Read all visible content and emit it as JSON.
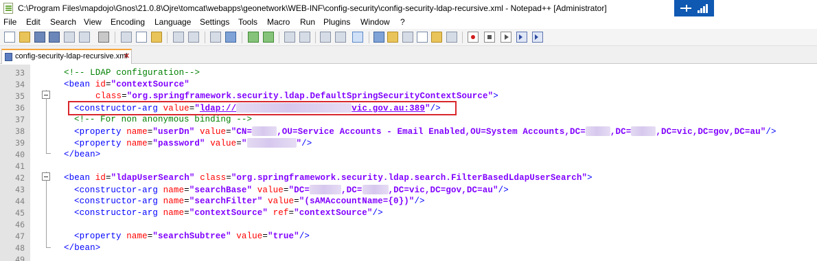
{
  "window": {
    "title": "C:\\Program Files\\mapdojo\\Gnos\\21.0.8\\Ojre\\tomcat\\webapps\\geonetwork\\WEB-INF\\config-security\\config-security-ldap-recursive.xml - Notepad++ [Administrator]",
    "tray_color": "#0f59b2"
  },
  "menu": [
    "File",
    "Edit",
    "Search",
    "View",
    "Encoding",
    "Language",
    "Settings",
    "Tools",
    "Macro",
    "Run",
    "Plugins",
    "Window",
    "?"
  ],
  "toolbar": {
    "icons": [
      "new-file-icon",
      "open-file-icon",
      "save-icon",
      "save-all-icon",
      "close-icon",
      "close-all-icon",
      "print-icon",
      "cut-icon",
      "copy-icon",
      "paste-icon",
      "undo-icon",
      "redo-icon",
      "find-icon",
      "replace-icon",
      "zoom-in-icon",
      "zoom-out-icon",
      "sync-vertical-icon",
      "sync-horizontal-icon",
      "word-wrap-icon",
      "show-all-characters-icon",
      "indent-guide-icon",
      "language-udl-icon",
      "document-map-icon",
      "function-list-icon",
      "folder-as-workspace-icon",
      "monitoring-icon",
      "record-macro-icon",
      "stop-recording-icon",
      "playback-macro-icon",
      "run-macro-multiple-icon",
      "save-macro-icon"
    ]
  },
  "tab": {
    "label": "config-security-ldap-recursive.xml",
    "close": "✕"
  },
  "editor": {
    "colors": {
      "comment": "#008000",
      "tag": "#0000ff",
      "attribute": "#ff0000",
      "value": "#8000ff",
      "highlight_border": "#d9262c"
    },
    "lines": [
      {
        "n": "33",
        "comment": "<!-- LDAP configuration-->"
      },
      {
        "n": "34",
        "tag_open": "<bean",
        "attr1": "id",
        "val1": "\"contextSource\""
      },
      {
        "n": "35",
        "attr1": "class",
        "val1": "\"org.springframework.security.ldap.DefaultSpringSecurityContextSource\"",
        "tag_close": ">"
      },
      {
        "n": "36",
        "tag_open": "<constructor-arg",
        "attr1": "value",
        "val_prefix": "\"",
        "val_link_a": "ldap://",
        "val_link_b": "vic.gov.au:389",
        "val_suffix": "\"",
        "tag_close": "/>"
      },
      {
        "n": "37",
        "comment": "<!-- For non anonymous binding -->"
      },
      {
        "n": "38",
        "tag_open": "<property",
        "attr1": "name",
        "val1": "\"userDn\"",
        "attr2": "value",
        "val2a": "\"CN=",
        "val2b": ",OU=Service Accounts - Email Enabled,OU=System Accounts,DC=",
        "val2c": ",DC=",
        "val2d": ",DC=vic,DC=gov,DC=au\"",
        "tag_close": "/>"
      },
      {
        "n": "39",
        "tag_open": "<property",
        "attr1": "name",
        "val1": "\"password\"",
        "attr2": "value",
        "val2a": "\"",
        "val2b": "\"",
        "tag_close": "/>"
      },
      {
        "n": "40",
        "tag_open": "</bean>"
      },
      {
        "n": "41"
      },
      {
        "n": "42",
        "tag_open": "<bean",
        "attr1": "id",
        "val1": "\"ldapUserSearch\"",
        "attr2": "class",
        "val2": "\"org.springframework.security.ldap.search.FilterBasedLdapUserSearch\"",
        "tag_close": ">"
      },
      {
        "n": "43",
        "tag_open": "<constructor-arg",
        "attr1": "name",
        "val1": "\"searchBase\"",
        "attr2": "value",
        "val2a": "\"DC=",
        "val2b": ",DC=",
        "val2c": ",DC=vic,DC=gov,DC=au\"",
        "tag_close": "/>"
      },
      {
        "n": "44",
        "tag_open": "<constructor-arg",
        "attr1": "name",
        "val1": "\"searchFilter\"",
        "attr2": "value",
        "val2": "\"(sAMAccountName={0})\"",
        "tag_close": "/>"
      },
      {
        "n": "45",
        "tag_open": "<constructor-arg",
        "attr1": "name",
        "val1": "\"contextSource\"",
        "attr2": "ref",
        "val2": "\"contextSource\"",
        "tag_close": "/>"
      },
      {
        "n": "46"
      },
      {
        "n": "47",
        "tag_open": "<property",
        "attr1": "name",
        "val1": "\"searchSubtree\"",
        "attr2": "value",
        "val2": "\"true\"",
        "tag_close": "/>"
      },
      {
        "n": "48",
        "tag_open": "</bean>"
      },
      {
        "n": "49"
      }
    ]
  }
}
